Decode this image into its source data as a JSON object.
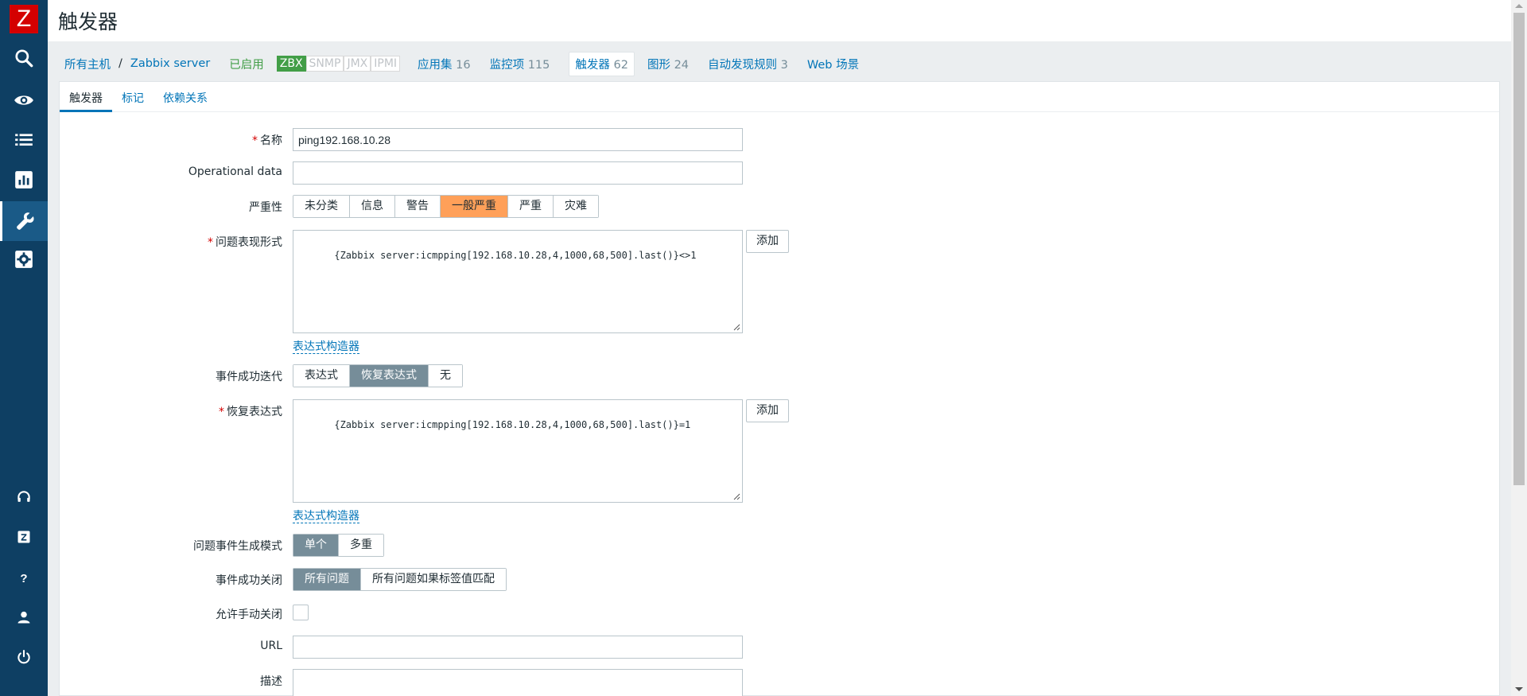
{
  "sidebar": {
    "logo": "Z",
    "icons": [
      "search-icon",
      "eye-icon",
      "list-icon",
      "chart-icon",
      "wrench-icon",
      "gear-icon",
      "headset-icon",
      "zabbix-share-icon",
      "help-icon",
      "user-icon",
      "power-icon"
    ]
  },
  "header": {
    "title": "触发器"
  },
  "host_nav": {
    "all_hosts": "所有主机",
    "separator": "/",
    "host": "Zabbix server",
    "status": "已启用",
    "badges": [
      "ZBX",
      "SNMP",
      "JMX",
      "IPMI"
    ],
    "items": [
      {
        "label": "应用集",
        "count": "16"
      },
      {
        "label": "监控项",
        "count": "115"
      },
      {
        "label": "触发器",
        "count": "62"
      },
      {
        "label": "图形",
        "count": "24"
      },
      {
        "label": "自动发现规则",
        "count": "3"
      },
      {
        "label": "Web 场景",
        "count": ""
      }
    ]
  },
  "tabs": [
    "触发器",
    "标记",
    "依赖关系"
  ],
  "form": {
    "name": {
      "label": "名称",
      "value": "ping192.168.10.28"
    },
    "opdata": {
      "label": "Operational data",
      "value": ""
    },
    "severity": {
      "label": "严重性",
      "options": [
        "未分类",
        "信息",
        "警告",
        "一般严重",
        "严重",
        "灾难"
      ],
      "selected": "一般严重"
    },
    "expression": {
      "label": "问题表现形式",
      "value": "{Zabbix server:icmpping[192.168.10.28,4,1000,68,500].last()}<>1",
      "add": "添加",
      "builder": "表达式构造器"
    },
    "ok_event": {
      "label": "事件成功迭代",
      "options": [
        "表达式",
        "恢复表达式",
        "无"
      ],
      "selected": "恢复表达式"
    },
    "recovery": {
      "label": "恢复表达式",
      "value": "{Zabbix server:icmpping[192.168.10.28,4,1000,68,500].last()}=1",
      "add": "添加",
      "builder": "表达式构造器"
    },
    "mode": {
      "label": "问题事件生成模式",
      "options": [
        "单个",
        "多重"
      ],
      "selected": "单个"
    },
    "ok_close": {
      "label": "事件成功关闭",
      "options": [
        "所有问题",
        "所有问题如果标签值匹配"
      ],
      "selected": "所有问题"
    },
    "manual_close": {
      "label": "允许手动关闭"
    },
    "url": {
      "label": "URL",
      "value": ""
    },
    "description": {
      "label": "描述"
    }
  },
  "colors": {
    "sidebar": "#0e3f63",
    "link": "#0275b8",
    "severity_average": "#ffa059",
    "enabled": "#429e47",
    "logo": "#d40000"
  }
}
